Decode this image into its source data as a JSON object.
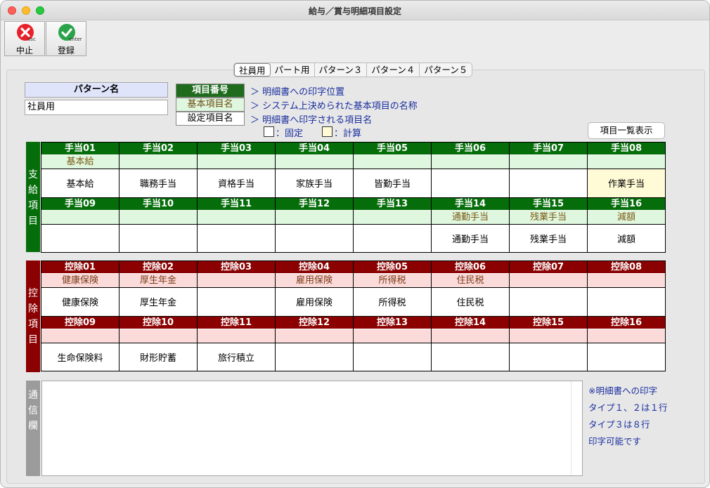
{
  "window": {
    "title": "給与／賞与明細項目設定"
  },
  "toolbar": {
    "cancel": {
      "label": "中止",
      "key": "esc",
      "icon": "cancel-icon"
    },
    "save": {
      "label": "登録",
      "key": "enter",
      "icon": "check-icon"
    }
  },
  "tabs": [
    "社員用",
    "パート用",
    "パターン３",
    "パターン４",
    "パターン５"
  ],
  "pattern": {
    "header": "パターン名",
    "value": "社員用"
  },
  "legend": {
    "item_no": "項目番号",
    "base_name": "基本項目名",
    "set_name": "設定項目名",
    "desc1": "＞ 明細書への印字位置",
    "desc2": "＞ システム上決められた基本項目の名称",
    "desc3": "＞ 明細書へ印字される項目名",
    "fixed": "：固定",
    "calc": "：計算"
  },
  "list_button": "項目一覧表示",
  "pay_label": [
    "支",
    "給",
    "項",
    "目"
  ],
  "ded_label": [
    "控",
    "除",
    "項",
    "目"
  ],
  "memo_label": [
    "通",
    "信",
    "欄"
  ],
  "pay_items": [
    {
      "num": "手当01",
      "base": "基本給",
      "name": "基本給"
    },
    {
      "num": "手当02",
      "base": "",
      "name": "職務手当"
    },
    {
      "num": "手当03",
      "base": "",
      "name": "資格手当"
    },
    {
      "num": "手当04",
      "base": "",
      "name": "家族手当"
    },
    {
      "num": "手当05",
      "base": "",
      "name": "皆勤手当"
    },
    {
      "num": "手当06",
      "base": "",
      "name": ""
    },
    {
      "num": "手当07",
      "base": "",
      "name": ""
    },
    {
      "num": "手当08",
      "base": "",
      "name": "作業手当"
    },
    {
      "num": "手当09",
      "base": "",
      "name": ""
    },
    {
      "num": "手当10",
      "base": "",
      "name": ""
    },
    {
      "num": "手当11",
      "base": "",
      "name": ""
    },
    {
      "num": "手当12",
      "base": "",
      "name": ""
    },
    {
      "num": "手当13",
      "base": "",
      "name": ""
    },
    {
      "num": "手当14",
      "base": "通勤手当",
      "name": "通勤手当"
    },
    {
      "num": "手当15",
      "base": "残業手当",
      "name": "残業手当"
    },
    {
      "num": "手当16",
      "base": "減額",
      "name": "減額"
    }
  ],
  "ded_items": [
    {
      "num": "控除01",
      "base": "健康保険",
      "name": "健康保険"
    },
    {
      "num": "控除02",
      "base": "厚生年金",
      "name": "厚生年金"
    },
    {
      "num": "控除03",
      "base": "",
      "name": ""
    },
    {
      "num": "控除04",
      "base": "雇用保険",
      "name": "雇用保険"
    },
    {
      "num": "控除05",
      "base": "所得税",
      "name": "所得税"
    },
    {
      "num": "控除06",
      "base": "住民税",
      "name": "住民税"
    },
    {
      "num": "控除07",
      "base": "",
      "name": ""
    },
    {
      "num": "控除08",
      "base": "",
      "name": ""
    },
    {
      "num": "控除09",
      "base": "",
      "name": "生命保険料"
    },
    {
      "num": "控除10",
      "base": "",
      "name": "財形貯蓄"
    },
    {
      "num": "控除11",
      "base": "",
      "name": "旅行積立"
    },
    {
      "num": "控除12",
      "base": "",
      "name": ""
    },
    {
      "num": "控除13",
      "base": "",
      "name": ""
    },
    {
      "num": "控除14",
      "base": "",
      "name": ""
    },
    {
      "num": "控除15",
      "base": "",
      "name": ""
    },
    {
      "num": "控除16",
      "base": "",
      "name": ""
    }
  ],
  "memo": {
    "value": ""
  },
  "notes": [
    "※明細書への印字",
    "タイプ１、２は１行",
    "タイプ３は８行",
    "印字可能です"
  ],
  "colors": {
    "pay": "#056d0a",
    "ded": "#8b0000",
    "calc": "#fffbd6"
  }
}
